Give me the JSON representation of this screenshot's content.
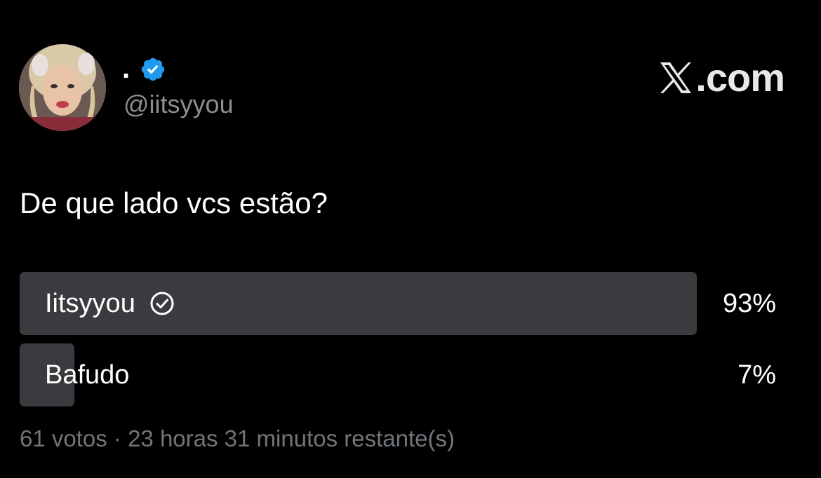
{
  "author": {
    "display_name": ".",
    "handle": "@iitsyyou",
    "verified": true,
    "verified_color": "#1d9bf0",
    "avatar_icon": "profile-photo"
  },
  "brand": {
    "text": ".com",
    "logo_icon": "x-logo-icon"
  },
  "tweet": {
    "text": "De que lado vcs estão?"
  },
  "poll": {
    "options": [
      {
        "label": "Iitsyyou",
        "percent_label": "93%",
        "percent": 93,
        "selected": true
      },
      {
        "label": "Bafudo",
        "percent_label": "7%",
        "percent": 7,
        "selected": false
      }
    ],
    "footer": "61 votos · 23 horas 31 minutos restante(s)",
    "bar_color": "#3a3b3e"
  }
}
